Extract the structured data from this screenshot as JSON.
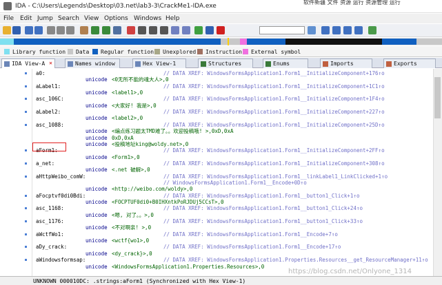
{
  "window": {
    "title": "IDA - C:\\Users\\Legends\\Desktop\\03.net\\lab3-3\\CrackMe1-IDA.exe",
    "hint": "软件新疆 文件 资源 运行 资源管理 运行"
  },
  "menu": [
    "File",
    "Edit",
    "Jump",
    "Search",
    "View",
    "Options",
    "Windows",
    "Help"
  ],
  "legend": [
    {
      "label": "Library function",
      "color": "#7fe0f0"
    },
    {
      "label": "Data",
      "color": "#c8c8c8"
    },
    {
      "label": "Regular function",
      "color": "#1060c0"
    },
    {
      "label": "Unexplored",
      "color": "#a8a888"
    },
    {
      "label": "Instruction",
      "color": "#a07060"
    },
    {
      "label": "External symbol",
      "color": "#f070e0"
    }
  ],
  "tabs": [
    {
      "label": "IDA View-A",
      "closable": true
    },
    {
      "label": "Names window",
      "closable": false
    },
    {
      "label": "Hex View-1",
      "closable": false
    },
    {
      "label": "Structures",
      "closable": false
    },
    {
      "label": "Enums",
      "closable": false
    },
    {
      "label": "Imports",
      "closable": false
    },
    {
      "label": "Exports",
      "closable": false
    }
  ],
  "code_lines": [
    {
      "label": "a0:",
      "op": "",
      "val": "",
      "xref": "// DATA XREF: WindowsFormsApplication1.Form1__InitializeComponent+176↑o"
    },
    {
      "label": "",
      "op": "unicode",
      "val": "<0无所不能的魂大人>,0",
      "xref": ""
    },
    {
      "label": "aLabel1:",
      "op": "",
      "val": "",
      "xref": "// DATA XREF: WindowsFormsApplication1.Form1__InitializeComponent+1C1↑o"
    },
    {
      "label": "",
      "op": "unicode",
      "val": "<label1>,0",
      "xref": ""
    },
    {
      "label": "asc_106C:",
      "op": "",
      "val": "",
      "xref": "// DATA XREF: WindowsFormsApplication1.Form1__InitializeComponent+1F4↑o"
    },
    {
      "label": "",
      "op": "unicode",
      "val": "<大家好! 我是>,0",
      "xref": ""
    },
    {
      "label": "aLabel2:",
      "op": "",
      "val": "",
      "xref": "// DATA XREF: WindowsFormsApplication1.Form1__InitializeComponent+227↑o"
    },
    {
      "label": "",
      "op": "unicode",
      "val": "<label2>,0",
      "xref": ""
    },
    {
      "label": "asc_1088:",
      "op": "",
      "val": "",
      "xref": "// DATA XREF: WindowsFormsApplication1.Form1__InitializeComponent+25D↑o"
    },
    {
      "label": "",
      "op": "unicode",
      "val": "<编点练习题太TMD难了。。欢迎投稿哦! >,0xD,0xA",
      "xref": ""
    },
    {
      "label": "",
      "op": "unicode",
      "val": "0xD,0xA",
      "xref": ""
    },
    {
      "label": "",
      "op": "unicode",
      "val": "<投稿地址king@woldy.net>,0",
      "xref": ""
    },
    {
      "label": "aForm1:",
      "op": "",
      "val": "",
      "xref": "// DATA XREF: WindowsFormsApplication1.Form1__InitializeComponent+2FF↑o"
    },
    {
      "label": "",
      "op": "unicode",
      "val": "<Form1>,0",
      "xref": ""
    },
    {
      "label": "a_net:",
      "op": "",
      "val": "",
      "xref": "// DATA XREF: WindowsFormsApplication1.Form1__InitializeComponent+308↑o"
    },
    {
      "label": "",
      "op": "unicode",
      "val": "<.net 破解>,0",
      "xref": ""
    },
    {
      "label": "aHttpWeibo_comW:",
      "op": "",
      "val": "",
      "xref": "// DATA XREF: WindowsFormsApplication1.Form1__linkLabel1_LinkClicked+1↑o"
    },
    {
      "label": "",
      "op": "",
      "val": "",
      "xref": "// WindowsFormsApplication1.Form1__Encode+0D↑o"
    },
    {
      "label": "",
      "op": "unicode",
      "val": "<http://weibo.com/woldy>,0",
      "xref": ""
    },
    {
      "label": "aFocptvf0di0Bdi:",
      "op": "",
      "val": "",
      "xref": "// DATA XREF: WindowsFormsApplication1.Form1__button1_Click+1↑o"
    },
    {
      "label": "",
      "op": "unicode",
      "val": "<FOCPTUF0di0+B0IHXntkPoRJDUj5CCsT>,0",
      "xref": ""
    },
    {
      "label": "asc_1168:",
      "op": "",
      "val": "",
      "xref": "// DATA XREF: WindowsFormsApplication1.Form1__button1_Click+24↑o"
    },
    {
      "label": "",
      "op": "unicode",
      "val": "<嗯, 对了。。>,0",
      "xref": ""
    },
    {
      "label": "asc_1176:",
      "op": "",
      "val": "",
      "xref": "// DATA XREF: WindowsFormsApplication1.Form1__button1_Click+33↑o"
    },
    {
      "label": "",
      "op": "unicode",
      "val": "<不对啊亲! >,0",
      "xref": ""
    },
    {
      "label": "aWctfWo1:",
      "op": "",
      "val": "",
      "xref": "// DATA XREF: WindowsFormsApplication1.Form1__Encode+7↑o"
    },
    {
      "label": "",
      "op": "unicode",
      "val": "<wctf{wo1>,0",
      "xref": ""
    },
    {
      "label": "aDy_crack:",
      "op": "",
      "val": "",
      "xref": "// DATA XREF: WindowsFormsApplication1.Form1__Encode+17↑o"
    },
    {
      "label": "",
      "op": "unicode",
      "val": "<dy_crack}>,0",
      "xref": ""
    },
    {
      "label": "aWindowsformsap:",
      "op": "",
      "val": "",
      "xref": "// DATA XREF: WindowsFormsApplication1.Properties.Resources__get_ResourceManager+11↑o"
    },
    {
      "label": "",
      "op": "unicode",
      "val": "<WindowsFormsApplication1.Properties.Resources>,0",
      "xref": ""
    }
  ],
  "status": "UNKNOWN 000010DC: .strings:aForm1 (Synchronized with Hex View-1)",
  "watermark": "https://blog.csdn.net/Onlyone_1314"
}
